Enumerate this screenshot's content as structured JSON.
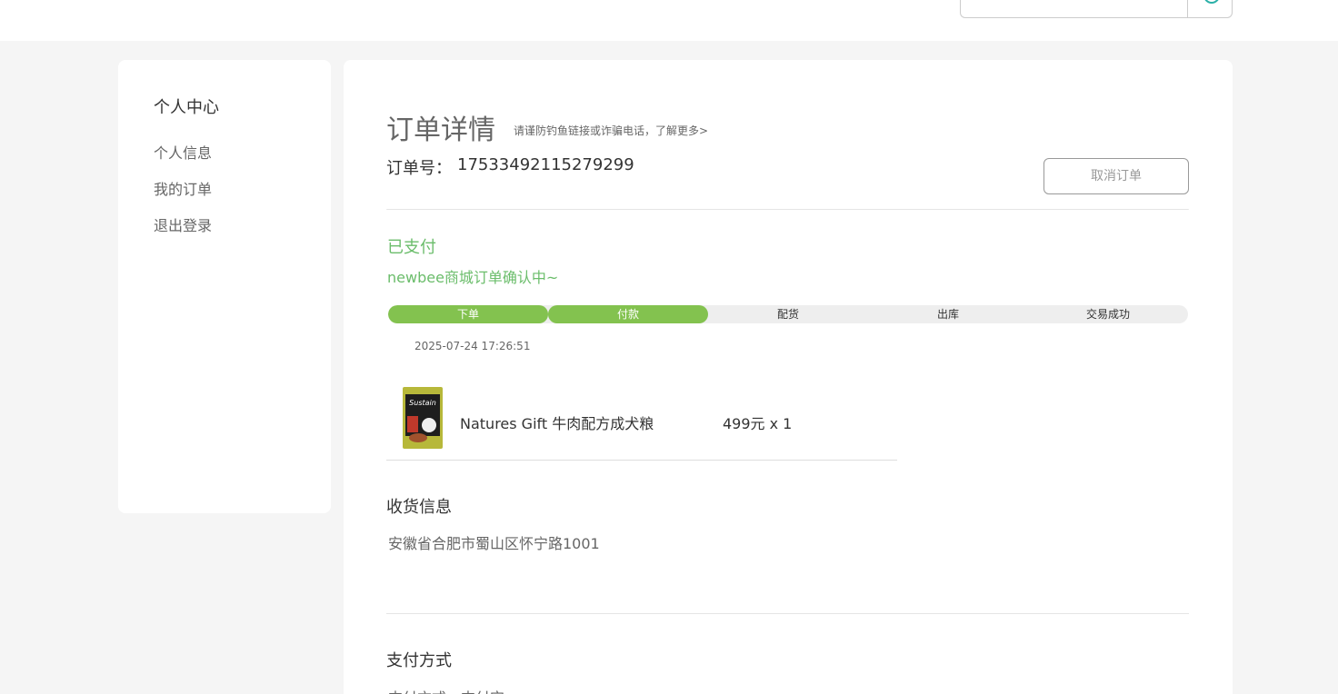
{
  "search": {
    "placeholder": ""
  },
  "sidebar": {
    "title": "个人中心",
    "items": [
      {
        "label": "个人信息"
      },
      {
        "label": "我的订单"
      },
      {
        "label": "退出登录"
      }
    ]
  },
  "order": {
    "title": "订单详情",
    "warning": "请谨防钓鱼链接或诈骗电话，了解更多>",
    "no_label": "订单号：",
    "no_value": "17533492115279299",
    "cancel_label": "取消订单",
    "status": "已支付",
    "status_msg": "newbee商城订单确认中~",
    "steps": [
      {
        "label": "下单",
        "done": true
      },
      {
        "label": "付款",
        "done": true
      },
      {
        "label": "配货",
        "done": false
      },
      {
        "label": "出库",
        "done": false
      },
      {
        "label": "交易成功",
        "done": false
      }
    ],
    "time": "2025-07-24 17:26:51",
    "goods": {
      "name": "Natures Gift 牛肉配方成犬粮",
      "price": "499元 x 1",
      "image_icon": "dog-food-bag-image"
    }
  },
  "shipping": {
    "title": "收货信息",
    "address": "安徽省合肥市蜀山区怀宁路1001"
  },
  "payment": {
    "title": "支付方式",
    "info": "支付方式：支付宝"
  },
  "colors": {
    "accent_green": "#83c24f",
    "status_green": "#6bbd6b"
  }
}
